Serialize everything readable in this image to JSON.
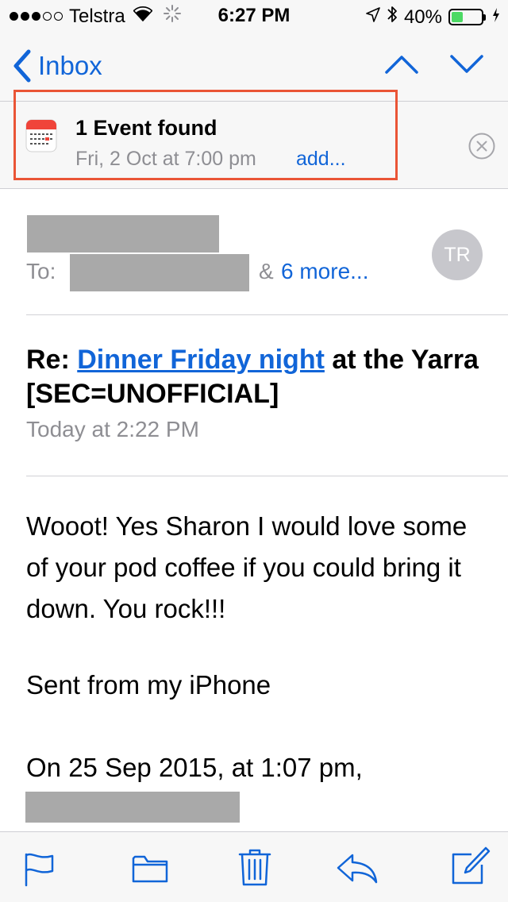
{
  "status_bar": {
    "carrier": "Telstra",
    "time": "6:27 PM",
    "battery": "40%",
    "battery_level": 0.4,
    "signal_bars": 3,
    "signal_total": 5
  },
  "nav": {
    "back_label": "Inbox"
  },
  "event": {
    "title": "1 Event found",
    "date": "Fri, 2 Oct at 7:00 pm",
    "add_label": "add..."
  },
  "header": {
    "to_label": "To:",
    "amp": "&",
    "more_label": "6 more...",
    "avatar_initials": "TR"
  },
  "message": {
    "subject_prefix": "Re: ",
    "subject_link": "Dinner Friday night",
    "subject_suffix": " at the Yarra [SEC=UNOFFICIAL]",
    "date": "Today at 2:22 PM",
    "body": "Wooot! Yes Sharon I would love some of your pod coffee if you could bring it down. You rock!!!",
    "signature": "Sent from my iPhone",
    "quote_intro": "On 25 Sep 2015, at 1:07 pm,"
  },
  "toolbar": {
    "icons": [
      "flag-icon",
      "folder-icon",
      "trash-icon",
      "reply-icon",
      "compose-icon"
    ]
  },
  "colors": {
    "accent": "#1165d8",
    "highlight": "#ea5536",
    "secondary_text": "#8e8e93",
    "battery_fill": "#4cd964",
    "redaction": "#a9a9a9"
  }
}
